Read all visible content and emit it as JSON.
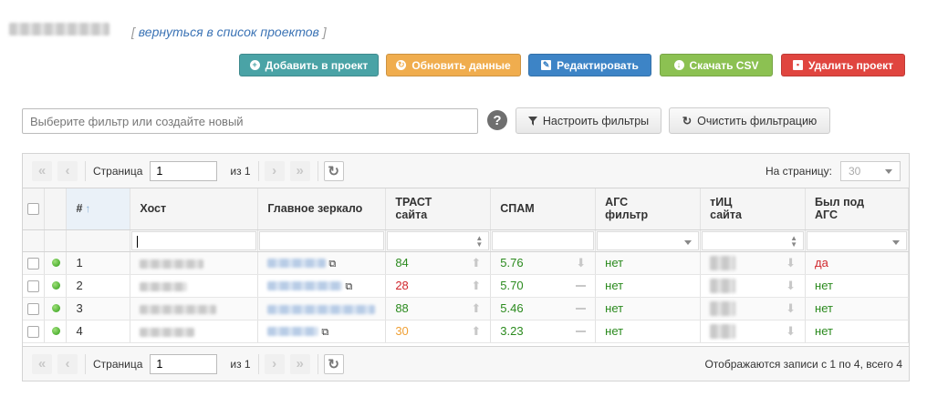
{
  "header": {
    "back_link_open": "[ ",
    "back_link": "вернуться в список проектов",
    "back_link_close": " ]"
  },
  "actions": {
    "add": "Добавить в проект",
    "update": "Обновить данные",
    "edit": "Редактировать",
    "csv": "Скачать CSV",
    "delete": "Удалить проект"
  },
  "filter": {
    "placeholder": "Выберите фильтр или создайте новый",
    "help": "?",
    "configure": "Настроить фильтры",
    "clear": "Очистить фильтрацию"
  },
  "pager": {
    "page_label": "Страница",
    "page_value": "1",
    "of_label": "из 1",
    "per_page_label": "На страницу:",
    "per_page_value": "30",
    "summary": "Отображаются записи с 1 по 4, всего 4"
  },
  "columns": {
    "num": "#",
    "host": "Хост",
    "mirror": "Главное зеркало",
    "trust_1": "ТРАСТ",
    "trust_2": "сайта",
    "spam": "СПАМ",
    "ags_1": "АГС",
    "ags_2": "фильтр",
    "tic_1": "тИЦ",
    "tic_2": "сайта",
    "was_1": "Был под",
    "was_2": "АГС"
  },
  "rows": [
    {
      "num": "1",
      "trust": "84",
      "trust_color": "#2b8a1e",
      "spam": "5.76",
      "spam_trend": "down",
      "ags": "нет",
      "was": "да",
      "was_color": "#d0262c"
    },
    {
      "num": "2",
      "trust": "28",
      "trust_color": "#d0262c",
      "spam": "5.70",
      "spam_trend": "flat",
      "ags": "нет",
      "was": "нет",
      "was_color": "#2b8a1e"
    },
    {
      "num": "3",
      "trust": "88",
      "trust_color": "#2b8a1e",
      "spam": "5.46",
      "spam_trend": "flat",
      "ags": "нет",
      "was": "нет",
      "was_color": "#2b8a1e"
    },
    {
      "num": "4",
      "trust": "30",
      "trust_color": "#f0a035",
      "spam": "3.23",
      "spam_trend": "flat",
      "ags": "нет",
      "was": "нет",
      "was_color": "#2b8a1e"
    }
  ]
}
